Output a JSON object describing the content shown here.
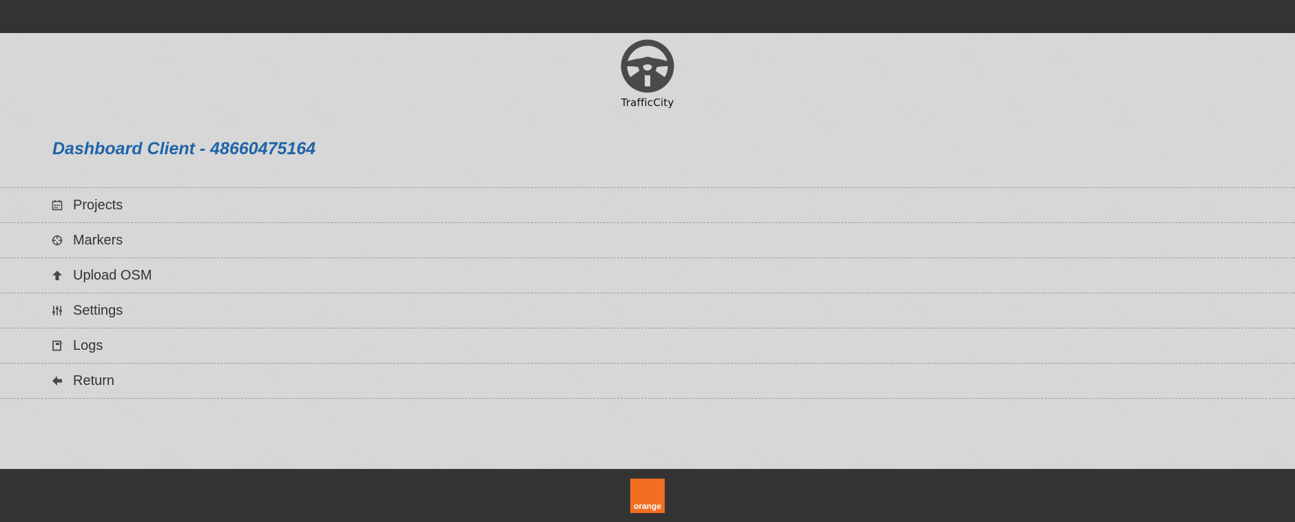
{
  "brand": {
    "name": "TrafficCity",
    "icon": "steering-wheel-icon"
  },
  "page": {
    "title": "Dashboard Client - 48660475164"
  },
  "menu": {
    "items": [
      {
        "label": "Projects",
        "icon": "calendar-icon"
      },
      {
        "label": "Markers",
        "icon": "crosshair-icon"
      },
      {
        "label": "Upload OSM",
        "icon": "arrow-up-icon"
      },
      {
        "label": "Settings",
        "icon": "sliders-icon"
      },
      {
        "label": "Logs",
        "icon": "notebook-icon"
      },
      {
        "label": "Return",
        "icon": "arrow-left-icon"
      }
    ]
  },
  "footer": {
    "logo_text": "orange"
  },
  "colors": {
    "bar": "#333333",
    "title": "#1f63a8",
    "orange": "#f16e22",
    "icon": "#4a4a4a"
  }
}
